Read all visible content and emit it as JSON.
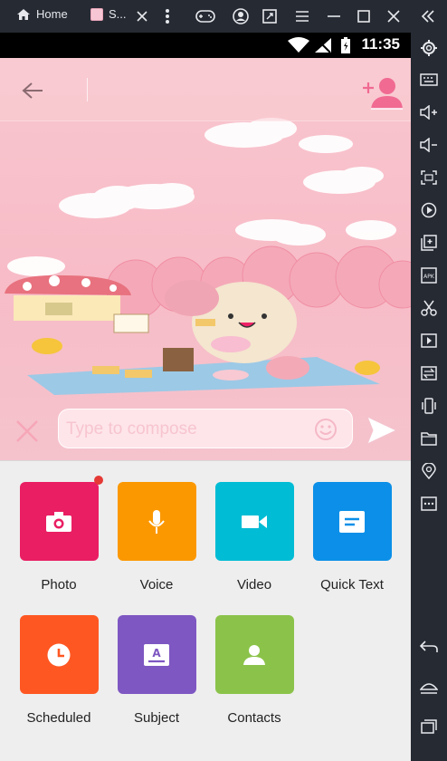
{
  "emulator": {
    "home_label": "Home",
    "tab_label": "S..."
  },
  "status": {
    "time": "11:35"
  },
  "composer": {
    "placeholder": "Type to compose"
  },
  "attachments": [
    {
      "label": "Photo",
      "color": "#e91e63",
      "icon": "camera-icon"
    },
    {
      "label": "Voice",
      "color": "#fb9800",
      "icon": "microphone-icon"
    },
    {
      "label": "Video",
      "color": "#00bcd4",
      "icon": "video-icon"
    },
    {
      "label": "Quick Text",
      "color": "#0b8fe8",
      "icon": "quick-text-icon"
    },
    {
      "label": "Scheduled",
      "color": "#ff5722",
      "icon": "clock-icon"
    },
    {
      "label": "Subject",
      "color": "#7e57c2",
      "icon": "subject-icon"
    },
    {
      "label": "Contacts",
      "color": "#8bc34a",
      "icon": "contact-icon"
    }
  ]
}
